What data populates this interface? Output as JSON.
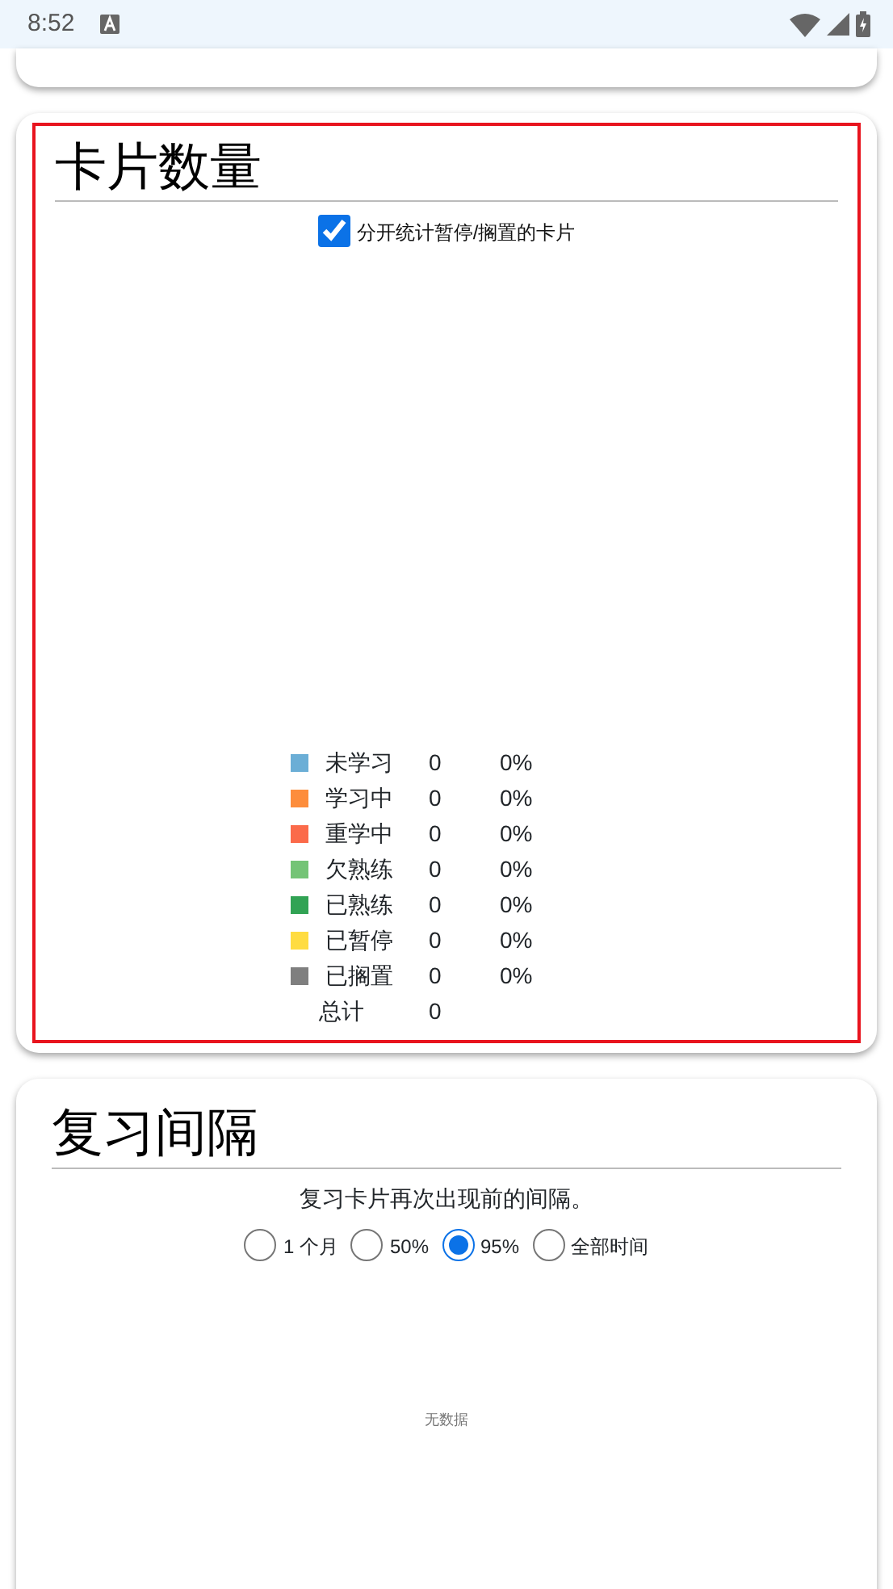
{
  "status_bar": {
    "time": "8:52"
  },
  "card_count": {
    "title": "卡片数量",
    "highlighted": true,
    "separate_option": {
      "label": "分开统计暂停/搁置的卡片",
      "checked": true
    },
    "legend": [
      {
        "label": "未学习",
        "count": "0",
        "percent": "0%",
        "color": "#6baed6"
      },
      {
        "label": "学习中",
        "count": "0",
        "percent": "0%",
        "color": "#fd8d3c"
      },
      {
        "label": "重学中",
        "count": "0",
        "percent": "0%",
        "color": "#fb6a4a"
      },
      {
        "label": "欠熟练",
        "count": "0",
        "percent": "0%",
        "color": "#74c476"
      },
      {
        "label": "已熟练",
        "count": "0",
        "percent": "0%",
        "color": "#31a354"
      },
      {
        "label": "已暂停",
        "count": "0",
        "percent": "0%",
        "color": "#ffdc41"
      },
      {
        "label": "已搁置",
        "count": "0",
        "percent": "0%",
        "color": "#7f7f7f"
      }
    ],
    "total": {
      "label": "总计",
      "count": "0"
    }
  },
  "review_intervals": {
    "title": "复习间隔",
    "subtitle": "复习卡片再次出现前的间隔。",
    "ranges": [
      {
        "label": "1 个月",
        "selected": false
      },
      {
        "label": "50%",
        "selected": false
      },
      {
        "label": "95%",
        "selected": true
      },
      {
        "label": "全部时间",
        "selected": false
      }
    ],
    "empty_text": "无数据"
  }
}
